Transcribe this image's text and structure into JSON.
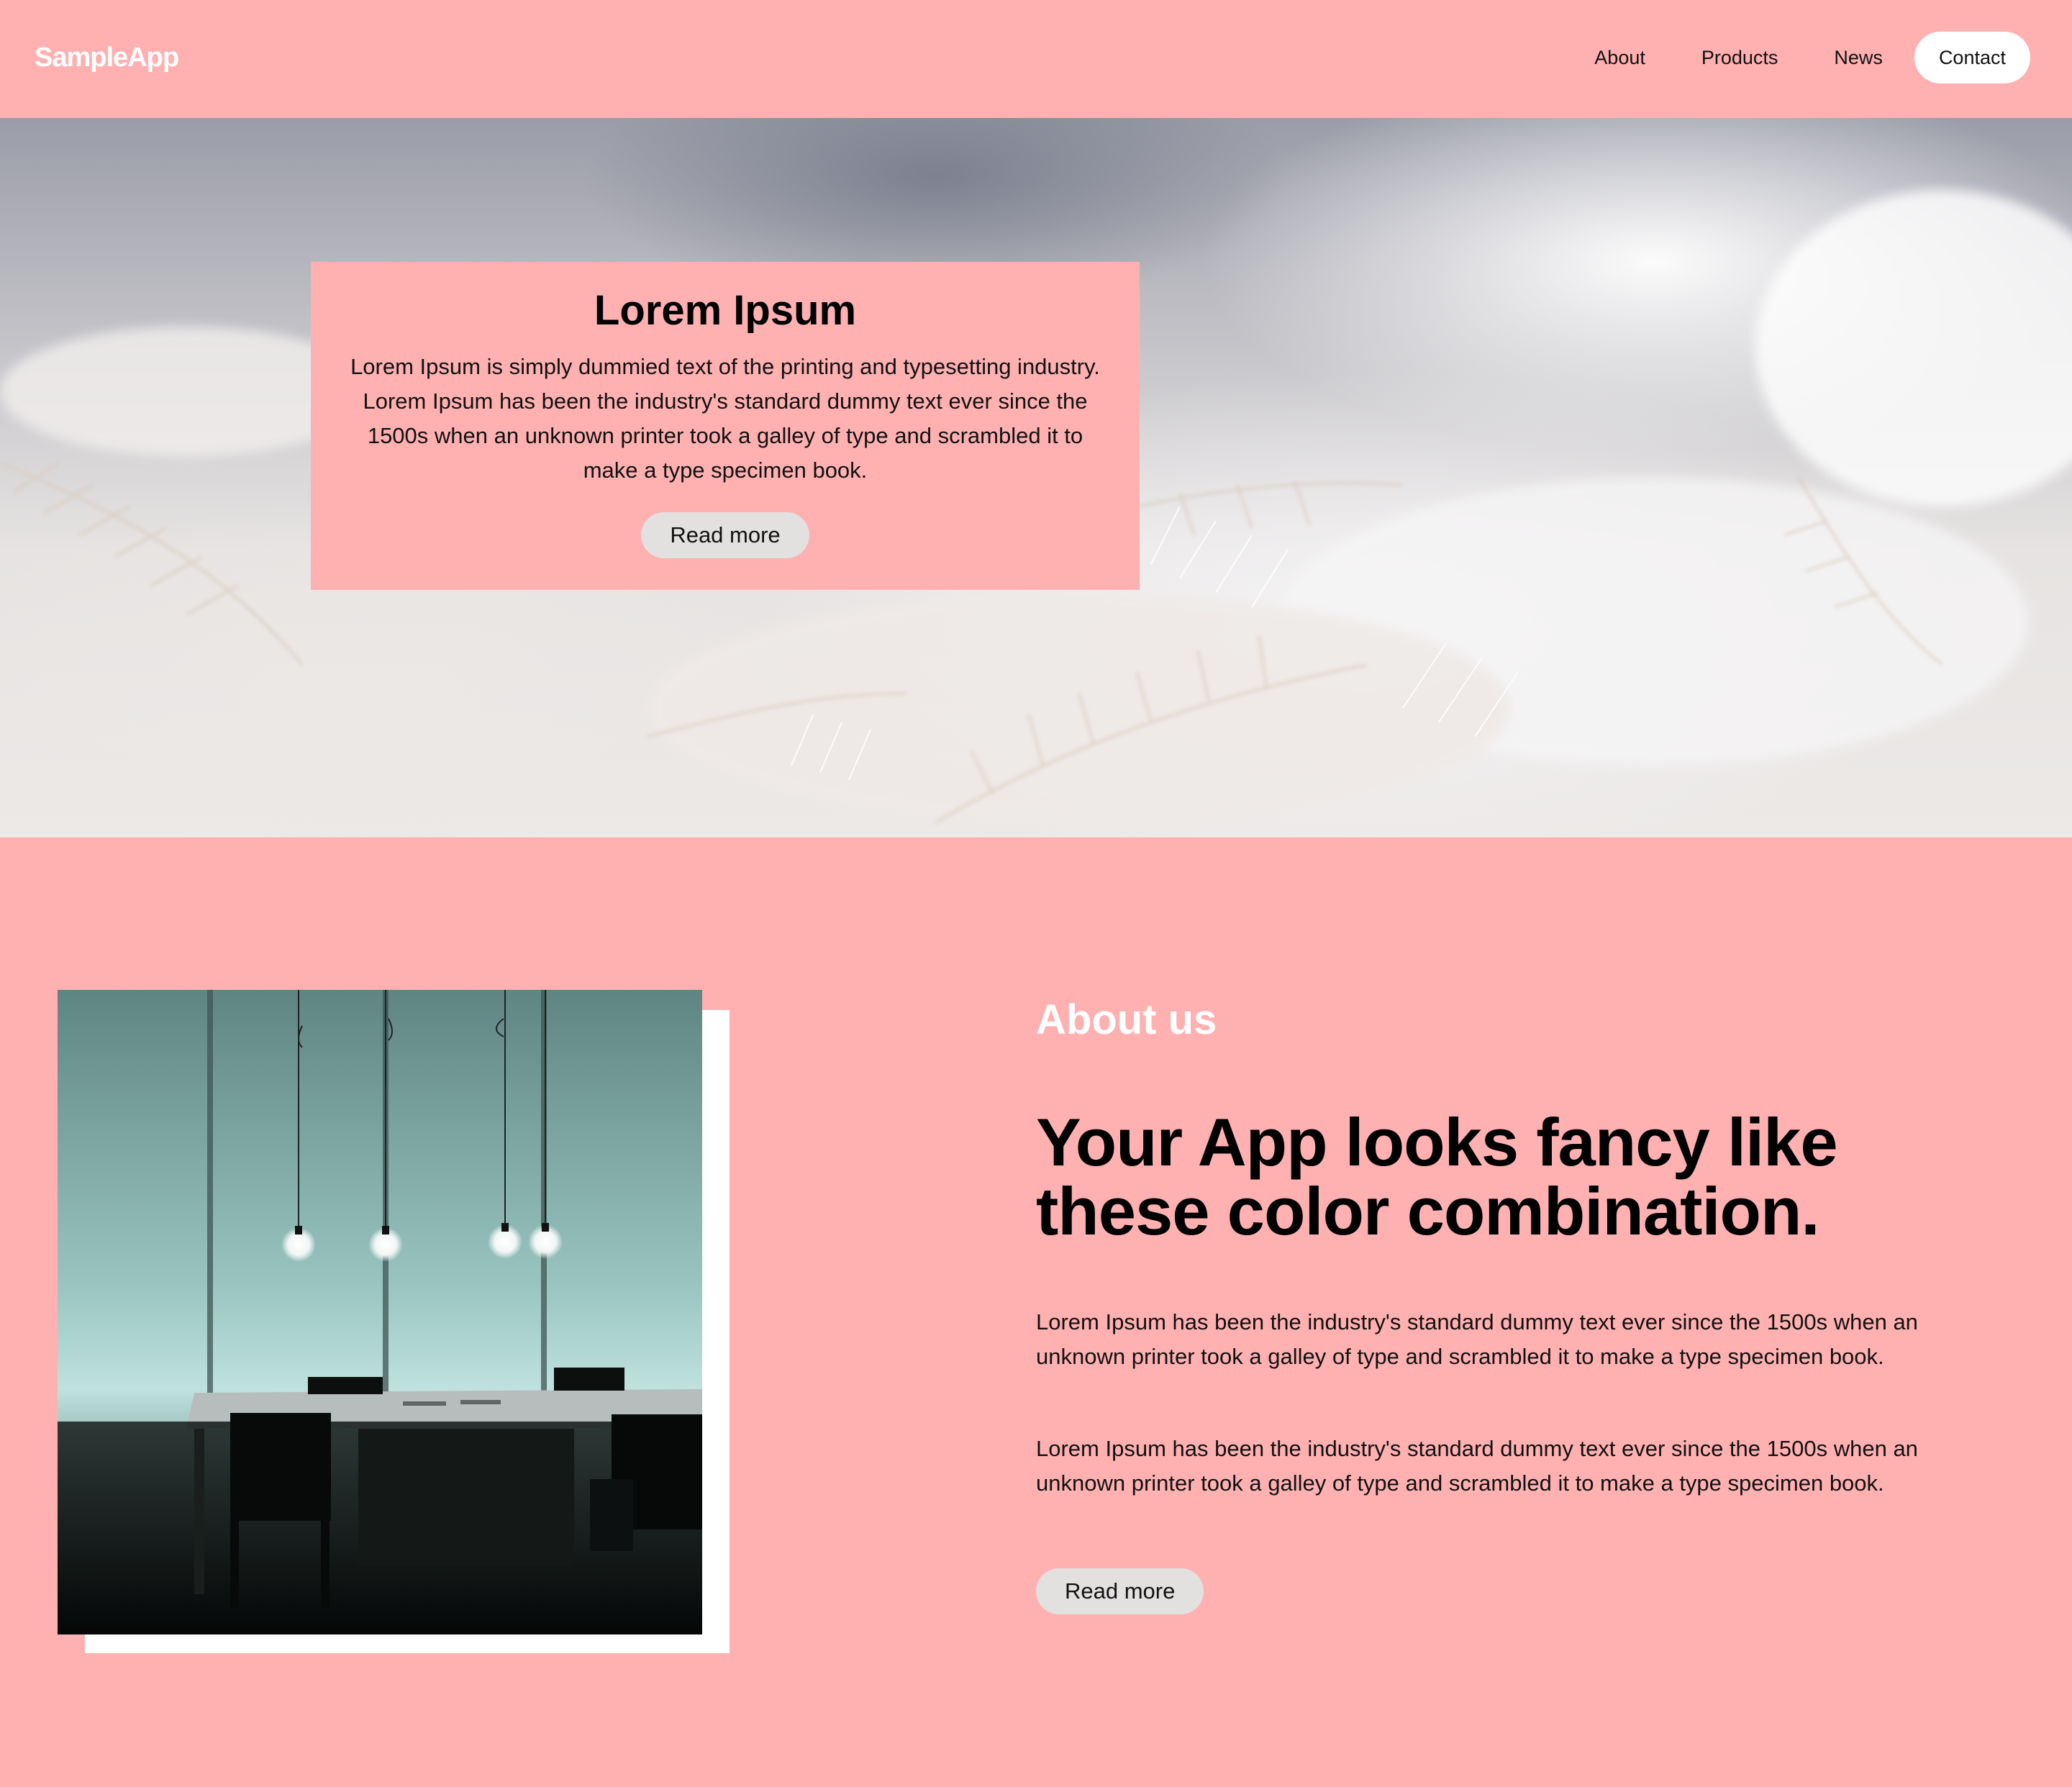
{
  "header": {
    "logo": "SampleApp",
    "nav": [
      {
        "label": "About",
        "active": false
      },
      {
        "label": "Products",
        "active": false
      },
      {
        "label": "News",
        "active": false
      },
      {
        "label": "Contact",
        "active": true
      }
    ]
  },
  "hero": {
    "title": "Lorem Ipsum",
    "text": "Lorem Ipsum is simply dummied text of the printing and typesetting industry. Lorem Ipsum has been the industry's standard dummy text ever since the 1500s when an unknown printer took a galley of type and scrambled it to make a type specimen book.",
    "button_label": "Read more"
  },
  "about": {
    "label": "About us",
    "heading": "Your App looks fancy like these color combination.",
    "paragraphs": [
      "Lorem Ipsum has been the industry's standard dummy text ever since the 1500s when an unknown printer took a galley of type and scrambled it to make a type specimen book.",
      "Lorem Ipsum has been the industry's standard dummy text ever since the 1500s when an unknown printer took a galley of type and scrambled it to make a type specimen book."
    ],
    "button_label": "Read more"
  },
  "colors": {
    "background": "#ffb1b2",
    "accent_white": "#ffffff",
    "button": "#e3e0e0",
    "text": "#000000"
  }
}
